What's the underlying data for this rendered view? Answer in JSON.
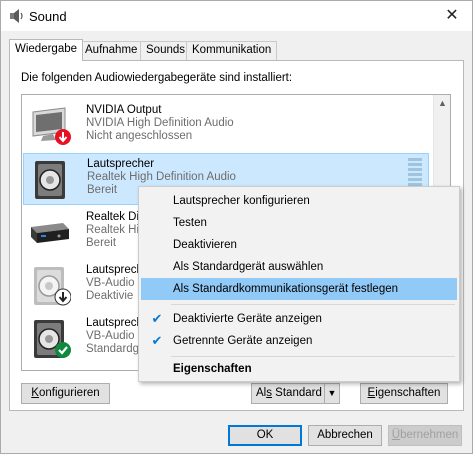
{
  "window": {
    "title": "Sound",
    "close_glyph": "✕"
  },
  "tabs": [
    {
      "label": "Wiedergabe",
      "active": true
    },
    {
      "label": "Aufnahme",
      "active": false
    },
    {
      "label": "Sounds",
      "active": false
    },
    {
      "label": "Kommunikation",
      "active": false
    }
  ],
  "panel": {
    "description": "Die folgenden Audiowiedergabegeräte sind installiert:"
  },
  "devices": [
    {
      "name": "NVIDIA Output",
      "line2": "NVIDIA High Definition Audio",
      "status": "Nicht angeschlossen",
      "icon": "monitor-icon",
      "badge": "red-down-arrow-badge"
    },
    {
      "name": "Lautsprecher",
      "line2": "Realtek High Definition Audio",
      "status": "Bereit",
      "icon": "speaker-icon",
      "selected": true
    },
    {
      "name": "Realtek Di",
      "line2": "Realtek Hi",
      "status": "Bereit",
      "icon": "digital-output-icon"
    },
    {
      "name": "Lautsprech",
      "line2": "VB-Audio",
      "status": "Deaktivie",
      "icon": "speaker-icon",
      "badge": "black-down-arrow-badge",
      "disabled": true
    },
    {
      "name": "Lautsprech",
      "line2": "VB-Audio",
      "status": "Standardg",
      "icon": "speaker-icon",
      "badge": "green-check-badge"
    }
  ],
  "panel_buttons": {
    "configure": {
      "accel": "K",
      "rest": "onfigurieren"
    },
    "set_default": {
      "pre": "Al",
      "accel": "s",
      "rest": " Standard"
    },
    "properties": {
      "accel": "E",
      "rest": "igenschaften"
    }
  },
  "dialog_buttons": {
    "ok": "OK",
    "cancel": "Abbrechen",
    "apply": {
      "accel": "Ü",
      "rest": "bernehmen"
    }
  },
  "context_menu": {
    "items": [
      {
        "label": "Lautsprecher konfigurieren"
      },
      {
        "label": "Testen"
      },
      {
        "label": "Deaktivieren"
      },
      {
        "label": "Als Standardgerät auswählen"
      },
      {
        "label": "Als Standardkommunikationsgerät festlegen",
        "highlighted": true
      },
      {
        "label": "Deaktivierte Geräte anzeigen",
        "checked": true
      },
      {
        "label": "Getrennte Geräte anzeigen",
        "checked": true
      },
      {
        "label": "Eigenschaften",
        "bold": true
      }
    ],
    "check_glyph": "✔"
  },
  "colors": {
    "selection_bg": "#cce8ff",
    "menu_hover": "#91c9f7",
    "accent": "#0078d7",
    "badge_red": "#e81123",
    "badge_green": "#10893e"
  }
}
